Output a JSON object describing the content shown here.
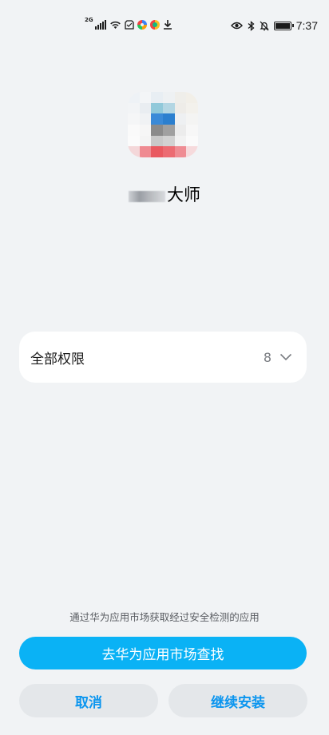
{
  "status_bar": {
    "network": "2G",
    "time": "7:37",
    "icons": [
      "signal-icon",
      "wifi-icon",
      "clipboard-icon",
      "app-swirl-icon",
      "app-dots-icon",
      "download-icon",
      "eye-icon",
      "bluetooth-icon",
      "bell-off-icon",
      "battery-icon"
    ]
  },
  "app": {
    "name_visible": "大师",
    "icon": "app-icon-pixelated"
  },
  "permissions": {
    "title": "全部权限",
    "count": "8"
  },
  "footer": {
    "hint": "通过华为应用市场获取经过安全检测的应用",
    "primary_label": "去华为应用市场查找",
    "cancel_label": "取消",
    "continue_label": "继续安装"
  },
  "colors": {
    "background": "#f1f3f5",
    "primary": "#0ab2f5",
    "secondary_text": "#0a95ef",
    "secondary_bg": "#e4e7ea"
  }
}
